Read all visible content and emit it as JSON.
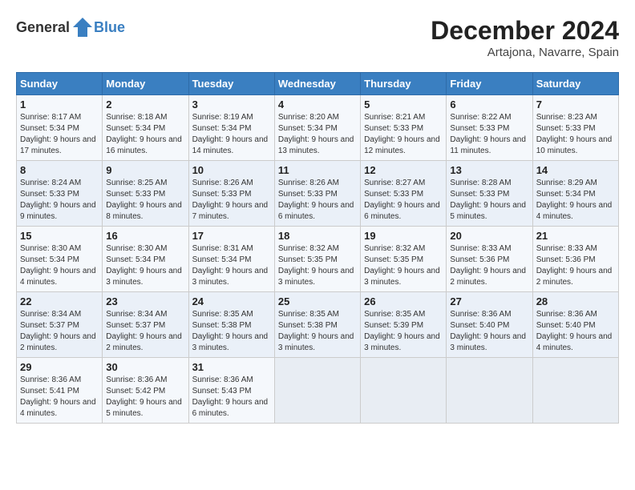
{
  "header": {
    "logo_general": "General",
    "logo_blue": "Blue",
    "month": "December 2024",
    "location": "Artajona, Navarre, Spain"
  },
  "weekdays": [
    "Sunday",
    "Monday",
    "Tuesday",
    "Wednesday",
    "Thursday",
    "Friday",
    "Saturday"
  ],
  "weeks": [
    [
      {
        "day": "1",
        "sunrise": "Sunrise: 8:17 AM",
        "sunset": "Sunset: 5:34 PM",
        "daylight": "Daylight: 9 hours and 17 minutes."
      },
      {
        "day": "2",
        "sunrise": "Sunrise: 8:18 AM",
        "sunset": "Sunset: 5:34 PM",
        "daylight": "Daylight: 9 hours and 16 minutes."
      },
      {
        "day": "3",
        "sunrise": "Sunrise: 8:19 AM",
        "sunset": "Sunset: 5:34 PM",
        "daylight": "Daylight: 9 hours and 14 minutes."
      },
      {
        "day": "4",
        "sunrise": "Sunrise: 8:20 AM",
        "sunset": "Sunset: 5:34 PM",
        "daylight": "Daylight: 9 hours and 13 minutes."
      },
      {
        "day": "5",
        "sunrise": "Sunrise: 8:21 AM",
        "sunset": "Sunset: 5:33 PM",
        "daylight": "Daylight: 9 hours and 12 minutes."
      },
      {
        "day": "6",
        "sunrise": "Sunrise: 8:22 AM",
        "sunset": "Sunset: 5:33 PM",
        "daylight": "Daylight: 9 hours and 11 minutes."
      },
      {
        "day": "7",
        "sunrise": "Sunrise: 8:23 AM",
        "sunset": "Sunset: 5:33 PM",
        "daylight": "Daylight: 9 hours and 10 minutes."
      }
    ],
    [
      {
        "day": "8",
        "sunrise": "Sunrise: 8:24 AM",
        "sunset": "Sunset: 5:33 PM",
        "daylight": "Daylight: 9 hours and 9 minutes."
      },
      {
        "day": "9",
        "sunrise": "Sunrise: 8:25 AM",
        "sunset": "Sunset: 5:33 PM",
        "daylight": "Daylight: 9 hours and 8 minutes."
      },
      {
        "day": "10",
        "sunrise": "Sunrise: 8:26 AM",
        "sunset": "Sunset: 5:33 PM",
        "daylight": "Daylight: 9 hours and 7 minutes."
      },
      {
        "day": "11",
        "sunrise": "Sunrise: 8:26 AM",
        "sunset": "Sunset: 5:33 PM",
        "daylight": "Daylight: 9 hours and 6 minutes."
      },
      {
        "day": "12",
        "sunrise": "Sunrise: 8:27 AM",
        "sunset": "Sunset: 5:33 PM",
        "daylight": "Daylight: 9 hours and 6 minutes."
      },
      {
        "day": "13",
        "sunrise": "Sunrise: 8:28 AM",
        "sunset": "Sunset: 5:33 PM",
        "daylight": "Daylight: 9 hours and 5 minutes."
      },
      {
        "day": "14",
        "sunrise": "Sunrise: 8:29 AM",
        "sunset": "Sunset: 5:34 PM",
        "daylight": "Daylight: 9 hours and 4 minutes."
      }
    ],
    [
      {
        "day": "15",
        "sunrise": "Sunrise: 8:30 AM",
        "sunset": "Sunset: 5:34 PM",
        "daylight": "Daylight: 9 hours and 4 minutes."
      },
      {
        "day": "16",
        "sunrise": "Sunrise: 8:30 AM",
        "sunset": "Sunset: 5:34 PM",
        "daylight": "Daylight: 9 hours and 3 minutes."
      },
      {
        "day": "17",
        "sunrise": "Sunrise: 8:31 AM",
        "sunset": "Sunset: 5:34 PM",
        "daylight": "Daylight: 9 hours and 3 minutes."
      },
      {
        "day": "18",
        "sunrise": "Sunrise: 8:32 AM",
        "sunset": "Sunset: 5:35 PM",
        "daylight": "Daylight: 9 hours and 3 minutes."
      },
      {
        "day": "19",
        "sunrise": "Sunrise: 8:32 AM",
        "sunset": "Sunset: 5:35 PM",
        "daylight": "Daylight: 9 hours and 3 minutes."
      },
      {
        "day": "20",
        "sunrise": "Sunrise: 8:33 AM",
        "sunset": "Sunset: 5:36 PM",
        "daylight": "Daylight: 9 hours and 2 minutes."
      },
      {
        "day": "21",
        "sunrise": "Sunrise: 8:33 AM",
        "sunset": "Sunset: 5:36 PM",
        "daylight": "Daylight: 9 hours and 2 minutes."
      }
    ],
    [
      {
        "day": "22",
        "sunrise": "Sunrise: 8:34 AM",
        "sunset": "Sunset: 5:37 PM",
        "daylight": "Daylight: 9 hours and 2 minutes."
      },
      {
        "day": "23",
        "sunrise": "Sunrise: 8:34 AM",
        "sunset": "Sunset: 5:37 PM",
        "daylight": "Daylight: 9 hours and 2 minutes."
      },
      {
        "day": "24",
        "sunrise": "Sunrise: 8:35 AM",
        "sunset": "Sunset: 5:38 PM",
        "daylight": "Daylight: 9 hours and 3 minutes."
      },
      {
        "day": "25",
        "sunrise": "Sunrise: 8:35 AM",
        "sunset": "Sunset: 5:38 PM",
        "daylight": "Daylight: 9 hours and 3 minutes."
      },
      {
        "day": "26",
        "sunrise": "Sunrise: 8:35 AM",
        "sunset": "Sunset: 5:39 PM",
        "daylight": "Daylight: 9 hours and 3 minutes."
      },
      {
        "day": "27",
        "sunrise": "Sunrise: 8:36 AM",
        "sunset": "Sunset: 5:40 PM",
        "daylight": "Daylight: 9 hours and 3 minutes."
      },
      {
        "day": "28",
        "sunrise": "Sunrise: 8:36 AM",
        "sunset": "Sunset: 5:40 PM",
        "daylight": "Daylight: 9 hours and 4 minutes."
      }
    ],
    [
      {
        "day": "29",
        "sunrise": "Sunrise: 8:36 AM",
        "sunset": "Sunset: 5:41 PM",
        "daylight": "Daylight: 9 hours and 4 minutes."
      },
      {
        "day": "30",
        "sunrise": "Sunrise: 8:36 AM",
        "sunset": "Sunset: 5:42 PM",
        "daylight": "Daylight: 9 hours and 5 minutes."
      },
      {
        "day": "31",
        "sunrise": "Sunrise: 8:36 AM",
        "sunset": "Sunset: 5:43 PM",
        "daylight": "Daylight: 9 hours and 6 minutes."
      },
      null,
      null,
      null,
      null
    ]
  ]
}
